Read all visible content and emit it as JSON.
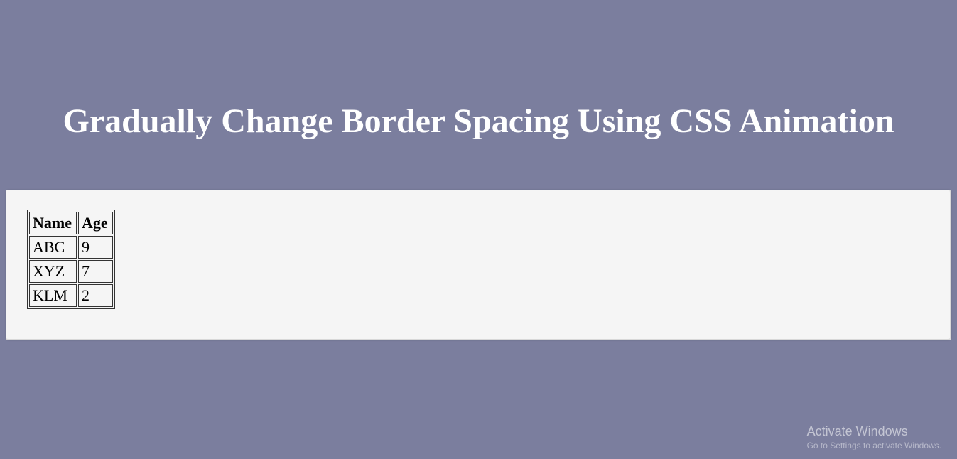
{
  "title": "Gradually Change Border Spacing Using CSS Animation",
  "table": {
    "headers": [
      "Name",
      "Age"
    ],
    "rows": [
      {
        "name": "ABC",
        "age": "9"
      },
      {
        "name": "XYZ",
        "age": "7"
      },
      {
        "name": "KLM",
        "age": "2"
      }
    ]
  },
  "watermark": {
    "title": "Activate Windows",
    "subtitle": "Go to Settings to activate Windows."
  }
}
